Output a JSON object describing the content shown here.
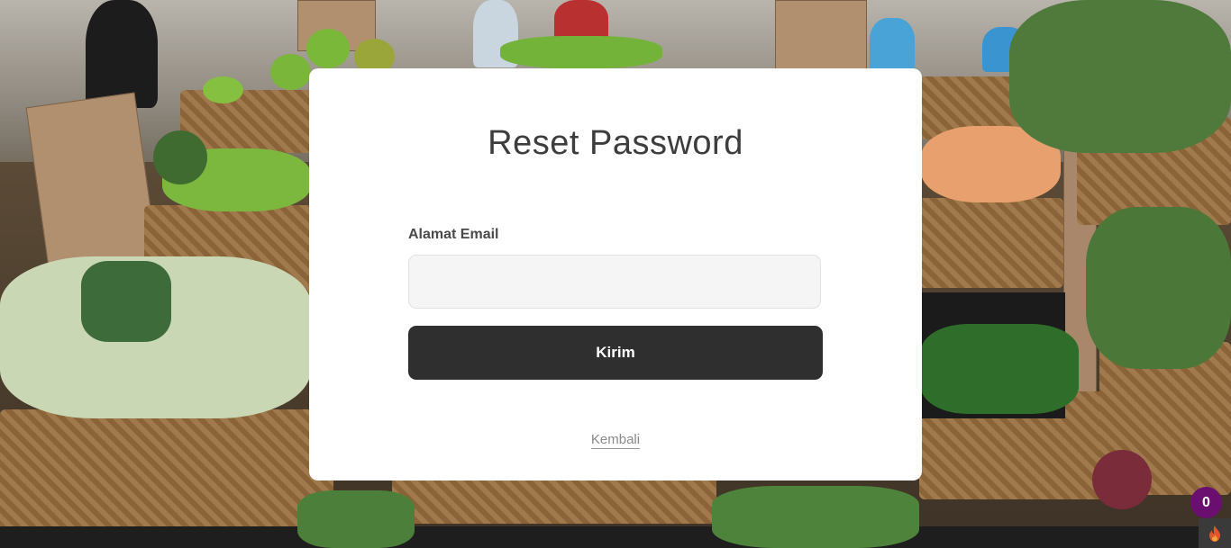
{
  "form": {
    "title": "Reset Password",
    "email_label": "Alamat Email",
    "email_value": "",
    "email_placeholder": "",
    "submit_label": "Kirim",
    "back_label": "Kembali"
  },
  "widgets": {
    "cart_count": "0",
    "cart_icon": "cart-count-badge",
    "fire_icon": "fire-icon"
  },
  "colors": {
    "button_bg": "#2f2f2f",
    "badge_bg": "#6a0f6f"
  }
}
